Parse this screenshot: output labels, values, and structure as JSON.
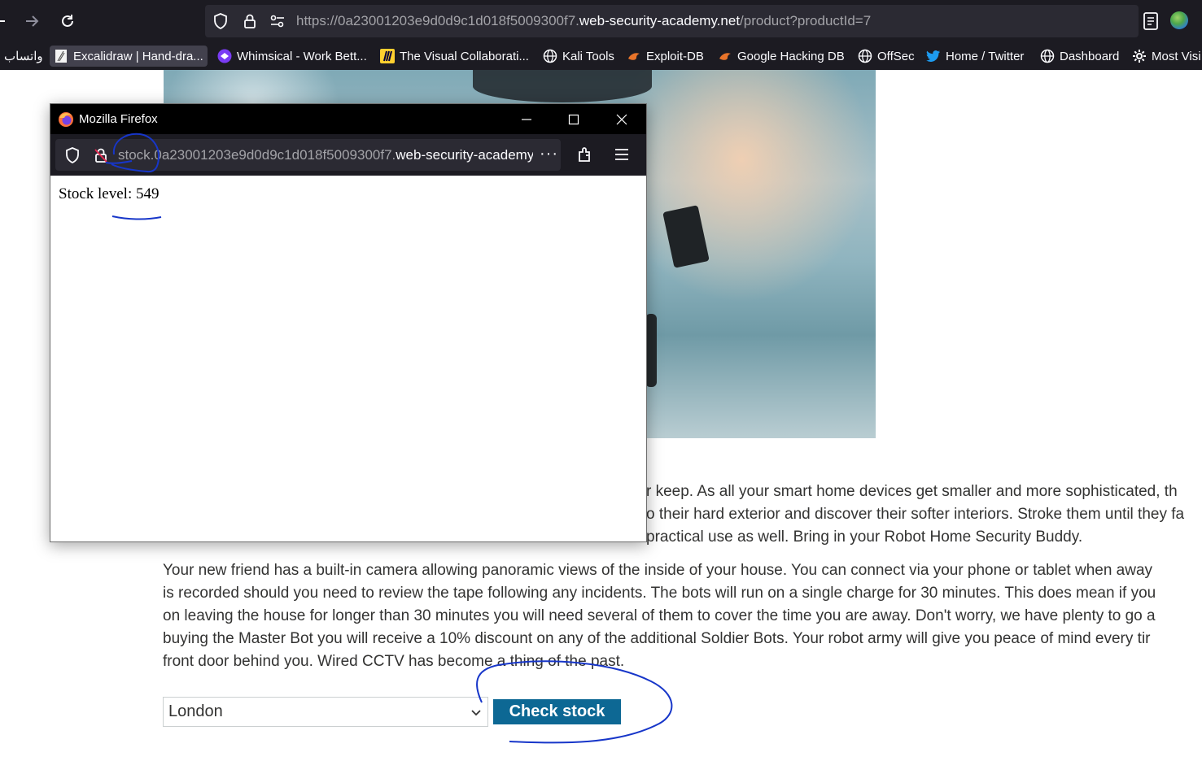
{
  "browser": {
    "url": {
      "prefix": "https://0a23001203e9d0d9c1d018f5009300f7.",
      "domain": "web-security-academy.net",
      "path": "/product?productId=7"
    },
    "bookmarks": [
      {
        "label": "واتساب",
        "icon": "whatsapp-icon"
      },
      {
        "label": "Excalidraw | Hand-dra...",
        "icon": "excalidraw-icon"
      },
      {
        "label": "Whimsical - Work Bett...",
        "icon": "whimsical-icon"
      },
      {
        "label": "The Visual Collaborati...",
        "icon": "miro-icon"
      },
      {
        "label": "Kali Tools",
        "icon": "globe-icon"
      },
      {
        "label": "Exploit-DB",
        "icon": "exploit-db-icon"
      },
      {
        "label": "Google Hacking DB",
        "icon": "exploit-db-icon"
      },
      {
        "label": "OffSec",
        "icon": "globe-icon"
      },
      {
        "label": "Home / Twitter",
        "icon": "twitter-icon"
      },
      {
        "label": "Dashboard",
        "icon": "globe-icon"
      },
      {
        "label": "Most Visi",
        "icon": "gear-icon"
      }
    ]
  },
  "page": {
    "description": [
      "r keep. As all your smart home devices get smaller and more sophisticated, th",
      "o their hard exterior and discover their softer interiors. Stroke them until they fa",
      "practical use as well. Bring in your Robot Home Security Buddy.",
      "Your new friend has a built-in camera allowing panoramic views of the inside of your house. You can connect via your phone or tablet when away",
      "is recorded should you need to review the tape following any incidents. The bots will run on a single charge for 30 minutes. This does mean if you",
      "on leaving the house for longer than 30 minutes you will need several of them to cover the time you are away. Don't worry, we have plenty to go a",
      "buying the Master Bot you will receive a 10% discount on any of the additional Soldier Bots. Your robot army will give you peace of mind every tir",
      "front door behind you. Wired CCTV has become a thing of the past."
    ],
    "store_select": "London",
    "check_stock_label": "Check stock"
  },
  "popup": {
    "window_title": "Mozilla Firefox",
    "url": {
      "prefix": "stock.0a23001203e9d0d9c1d018f5009300f7.",
      "domain": "web-security-academy",
      "more": "···"
    },
    "stock_text": "Stock level: 549"
  },
  "colors": {
    "chrome_bg": "#1c1b22",
    "urlbar_bg": "#2b2a33",
    "button_bg": "#0d6894",
    "annotation_ink": "#1736c9",
    "text": "#333332"
  }
}
